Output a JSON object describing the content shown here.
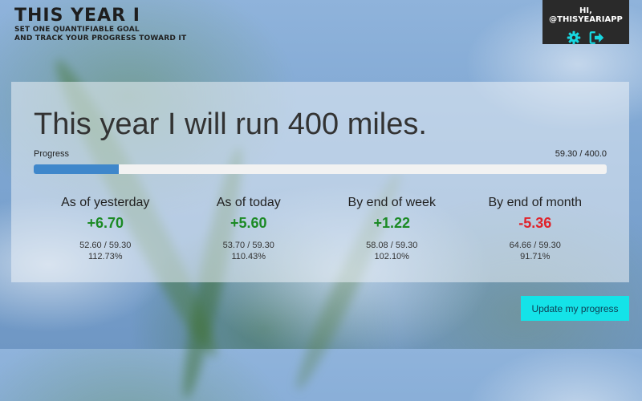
{
  "brand": {
    "title": "THIS YEAR I",
    "tagline_line1": "SET ONE QUANTIFIABLE GOAL",
    "tagline_line2": "AND TRACK YOUR PROGRESS TOWARD IT"
  },
  "user": {
    "greeting": "HI, @THISYEARIAPP",
    "icons": [
      "gear-icon",
      "sign-out-icon"
    ]
  },
  "goal": {
    "statement": "This year I will run 400 miles.",
    "progress_label": "Progress",
    "progress_text": "59.30 / 400.0",
    "progress_fraction": 0.148
  },
  "stats": [
    {
      "title": "As of yesterday",
      "delta": "+6.70",
      "sign": "pos",
      "ratio": "52.60 / 59.30",
      "percent": "112.73%"
    },
    {
      "title": "As of today",
      "delta": "+5.60",
      "sign": "pos",
      "ratio": "53.70 / 59.30",
      "percent": "110.43%"
    },
    {
      "title": "By end of week",
      "delta": "+1.22",
      "sign": "pos",
      "ratio": "58.08 / 59.30",
      "percent": "102.10%"
    },
    {
      "title": "By end of month",
      "delta": "-5.36",
      "sign": "neg",
      "ratio": "64.66 / 59.30",
      "percent": "91.71%"
    }
  ],
  "actions": {
    "update_label": "Update my progress"
  },
  "colors": {
    "positive": "#1b8a24",
    "negative": "#e0222a",
    "progress": "#3f87cb",
    "button": "#14e3e8"
  }
}
